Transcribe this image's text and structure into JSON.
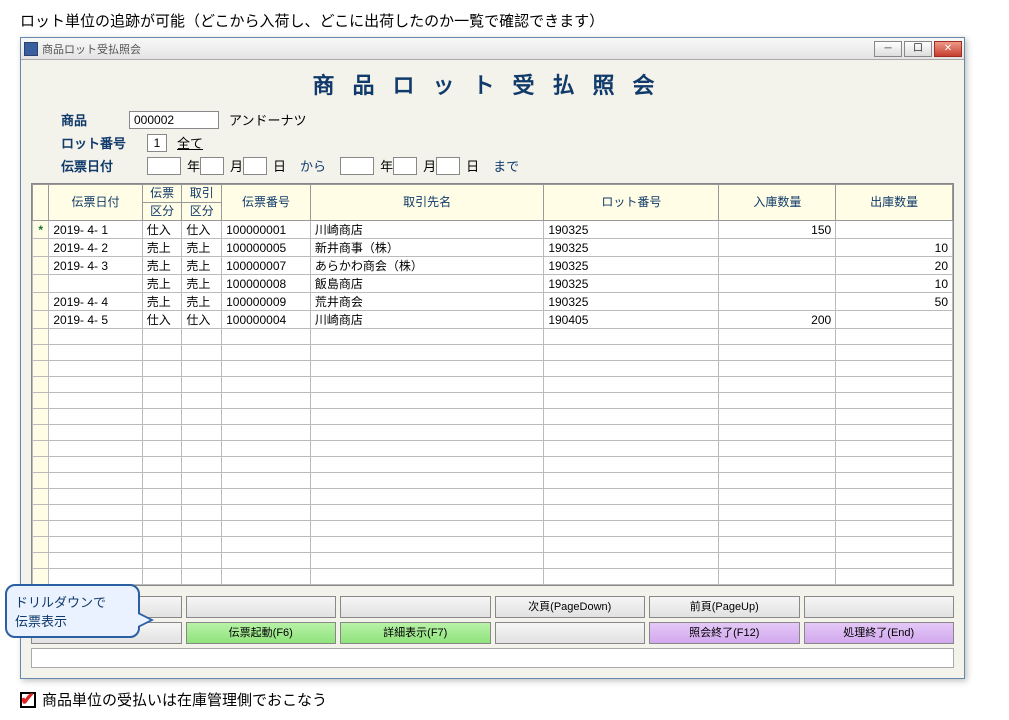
{
  "caption_top": "ロット単位の追跡が可能（どこから入荷し、どこに出荷したのか一覧で確認できます）",
  "titlebar": {
    "text": "商品ロット受払照会"
  },
  "big_title": "商品ロット受払照会",
  "product": {
    "label": "商品",
    "code": "000002",
    "name": "アンドーナツ"
  },
  "lot_no": {
    "label": "ロット番号",
    "value": "1",
    "suffix": "全て"
  },
  "date": {
    "label": "伝票日付",
    "unit_year": "年",
    "unit_month": "月",
    "unit_day": "日",
    "from_label": "から",
    "to_label": "まで"
  },
  "grid": {
    "headers": {
      "date": "伝票日付",
      "slip_kbn1": "伝票",
      "slip_kbn2": "区分",
      "deal_kbn1": "取引",
      "deal_kbn2": "区分",
      "slip_no": "伝票番号",
      "partner": "取引先名",
      "lot": "ロット番号",
      "in_qty": "入庫数量",
      "out_qty": "出庫数量"
    },
    "rows": [
      {
        "mark": "*",
        "date": "2019- 4- 1",
        "k1": "仕入",
        "k2": "仕入",
        "no": "100000001",
        "partner": "川崎商店",
        "lot": "190325",
        "in": "150",
        "out": ""
      },
      {
        "mark": "",
        "date": "2019- 4- 2",
        "k1": "売上",
        "k2": "売上",
        "no": "100000005",
        "partner": "新井商事（株）",
        "lot": "190325",
        "in": "",
        "out": "10"
      },
      {
        "mark": "",
        "date": "2019- 4- 3",
        "k1": "売上",
        "k2": "売上",
        "no": "100000007",
        "partner": "あらかわ商会（株）",
        "lot": "190325",
        "in": "",
        "out": "20"
      },
      {
        "mark": "",
        "date": "",
        "k1": "売上",
        "k2": "売上",
        "no": "100000008",
        "partner": "飯島商店",
        "lot": "190325",
        "in": "",
        "out": "10"
      },
      {
        "mark": "",
        "date": "2019- 4- 4",
        "k1": "売上",
        "k2": "売上",
        "no": "100000009",
        "partner": "荒井商会",
        "lot": "190325",
        "in": "",
        "out": "50"
      },
      {
        "mark": "",
        "date": "2019- 4- 5",
        "k1": "仕入",
        "k2": "仕入",
        "no": "100000004",
        "partner": "川崎商店",
        "lot": "190405",
        "in": "200",
        "out": ""
      }
    ]
  },
  "buttons": {
    "page_down": "次頁(PageDown)",
    "page_up": "前頁(PageUp)",
    "slip_open": "伝票起動(F6)",
    "detail": "詳細表示(F7)",
    "query_end": "照会終了(F12)",
    "proc_end": "処理終了(End)"
  },
  "callout": "ドリルダウンで\n伝票表示",
  "note_bottom": "商品単位の受払いは在庫管理側でおこなう"
}
